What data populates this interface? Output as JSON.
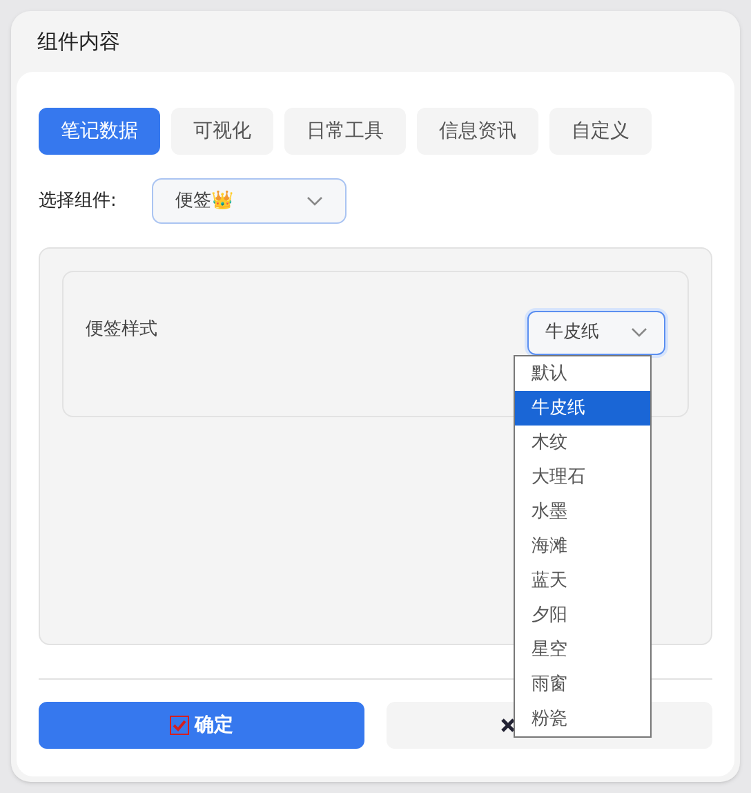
{
  "dialog": {
    "title": "组件内容"
  },
  "tabs": [
    {
      "label": "笔记数据",
      "selected": true
    },
    {
      "label": "可视化",
      "selected": false
    },
    {
      "label": "日常工具",
      "selected": false
    },
    {
      "label": "信息资讯",
      "selected": false
    },
    {
      "label": "自定义",
      "selected": false
    }
  ],
  "component_select": {
    "label": "选择组件:",
    "value": "便签👑"
  },
  "style_setting": {
    "label": "便签样式",
    "value": "牛皮纸",
    "expanded": true,
    "options": [
      {
        "label": "默认",
        "selected": false
      },
      {
        "label": "牛皮纸",
        "selected": true
      },
      {
        "label": "木纹",
        "selected": false
      },
      {
        "label": "大理石",
        "selected": false
      },
      {
        "label": "水墨",
        "selected": false
      },
      {
        "label": "海滩",
        "selected": false
      },
      {
        "label": "蓝天",
        "selected": false
      },
      {
        "label": "夕阳",
        "selected": false
      },
      {
        "label": "星空",
        "selected": false
      },
      {
        "label": "雨窗",
        "selected": false
      },
      {
        "label": "粉瓷",
        "selected": false
      }
    ]
  },
  "buttons": {
    "confirm": "确定"
  }
}
